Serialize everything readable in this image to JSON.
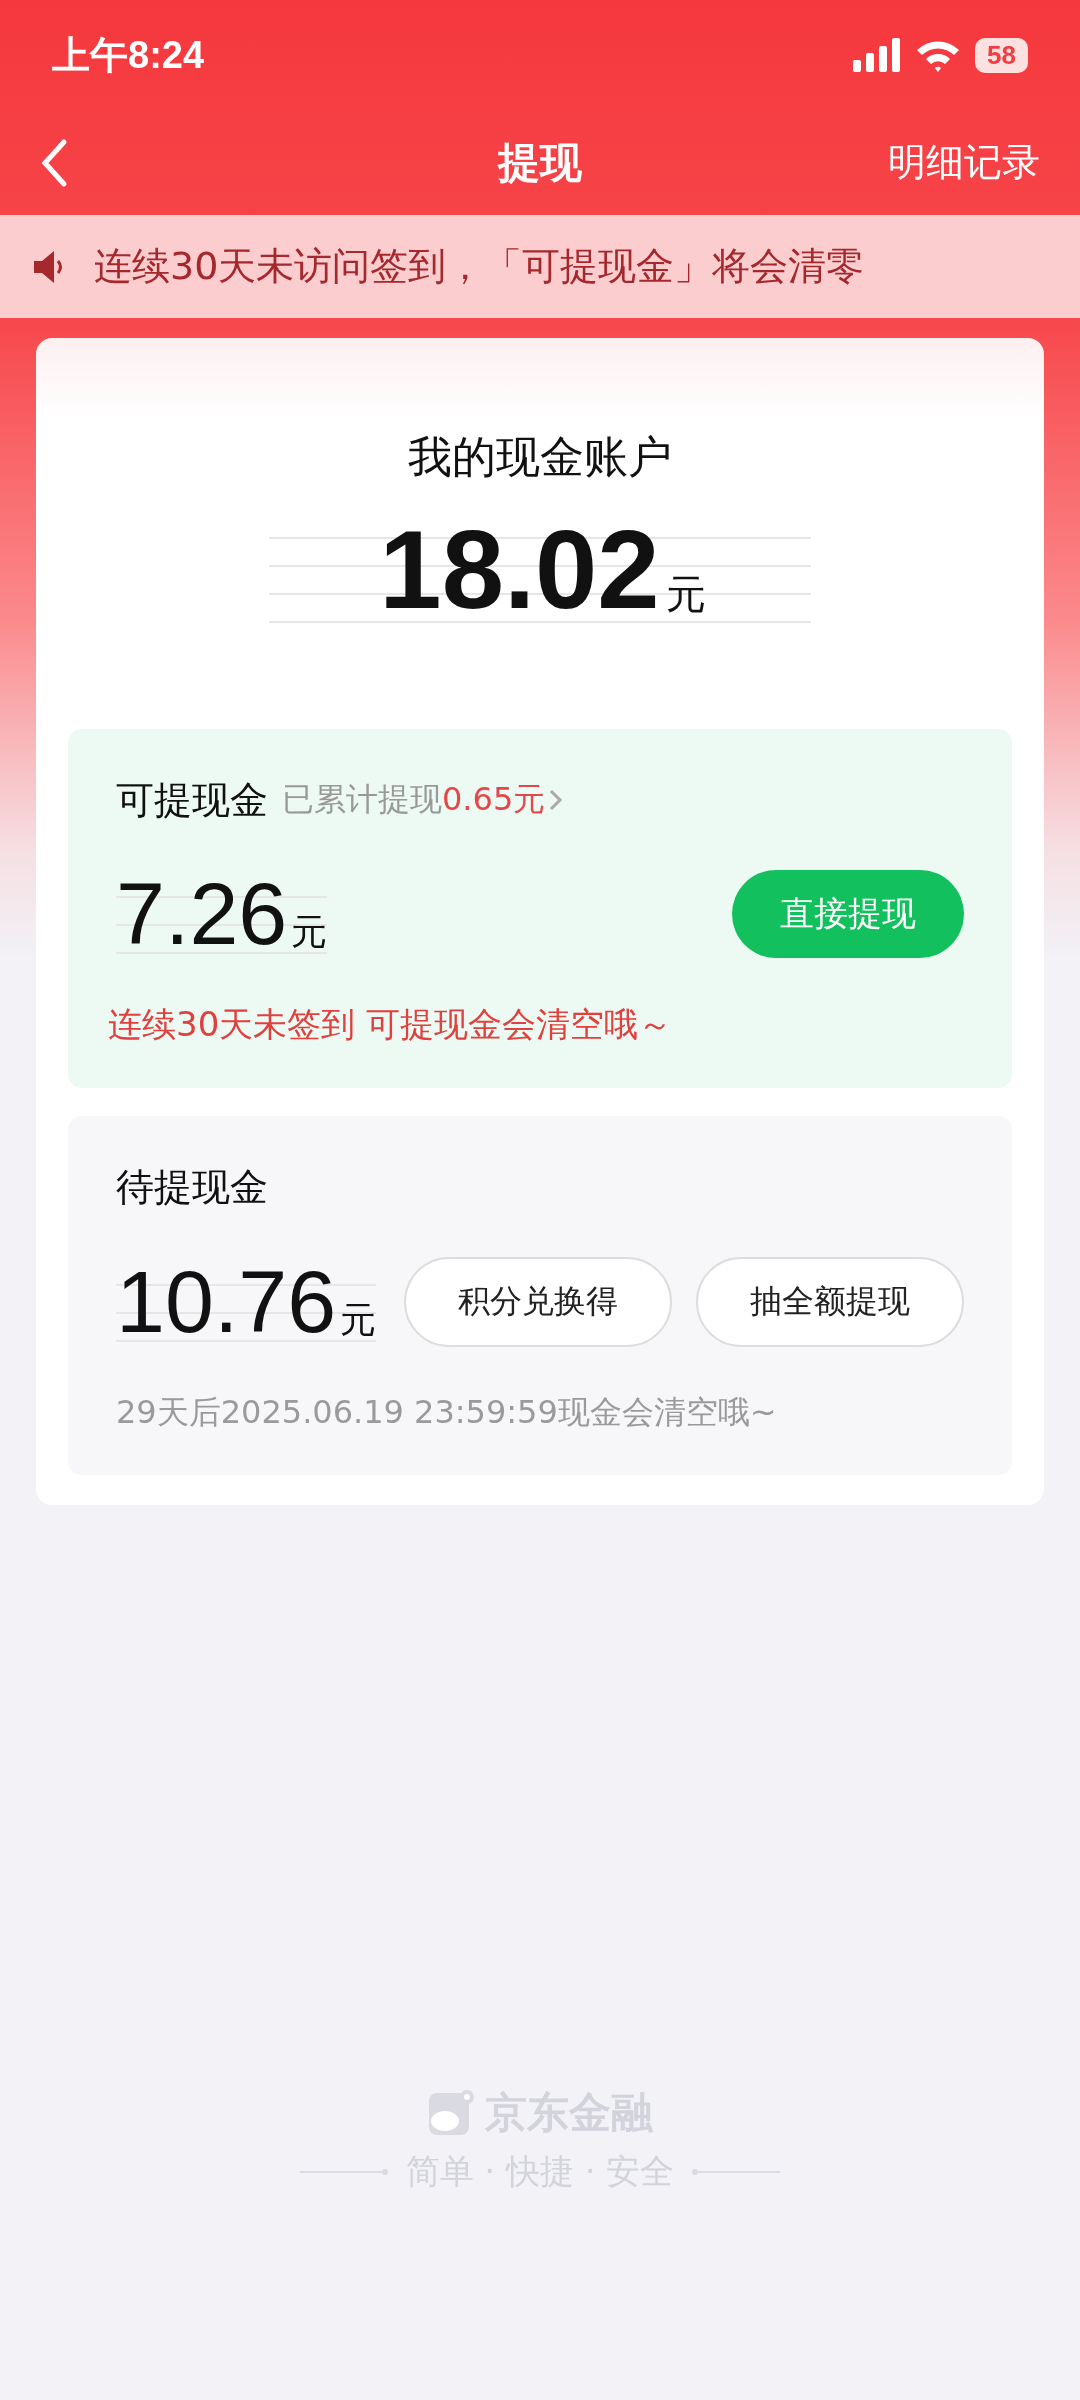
{
  "status_bar": {
    "time": "上午8:24",
    "battery": "58"
  },
  "nav": {
    "title": "提现",
    "action": "明细记录"
  },
  "notice": {
    "text": "连续30天未访问签到，「可提现金」将会清零"
  },
  "account": {
    "title": "我的现金账户",
    "amount": "18.02",
    "unit": "元"
  },
  "available": {
    "title": "可提现金",
    "history_label": "已累计提现",
    "history_amount": "0.65元",
    "amount": "7.26",
    "unit": "元",
    "button": "直接提现",
    "warning": "连续30天未签到 可提现金会清空哦～"
  },
  "pending": {
    "title": "待提现金",
    "amount": "10.76",
    "unit": "元",
    "buttons": [
      "积分兑换得",
      "抽全额提现"
    ],
    "note": "29天后2025.06.19 23:59:59现金会清空哦~"
  },
  "footer": {
    "brand": "京东金融",
    "tagline": "简单 · 快捷 · 安全"
  }
}
